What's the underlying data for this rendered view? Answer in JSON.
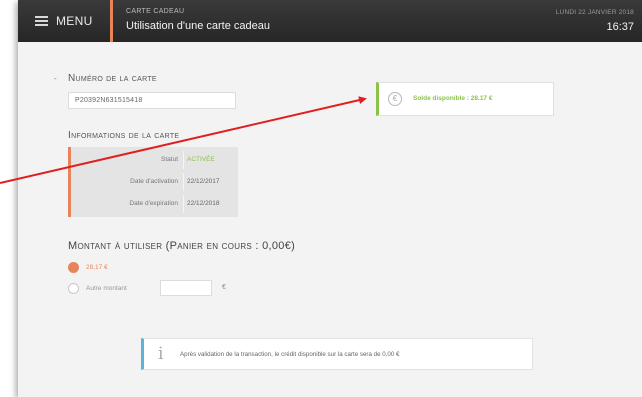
{
  "header": {
    "menu_label": "MENU",
    "menu_icon": "hamburger-icon",
    "breadcrumb": "CARTE CADEAU",
    "title": "Utilisation d'une carte cadeau",
    "date": "LUNDI 22 JANVIER 2018",
    "time": "16:37"
  },
  "card_number": {
    "title": "Numéro de la carte",
    "value": "P20392N631515418"
  },
  "balance": {
    "icon": "euro-icon",
    "text": "Solde disponible : 28.17 €"
  },
  "card_info": {
    "title": "Informations de la carte",
    "rows": [
      {
        "label": "Statut",
        "value": "ACTIVÉE"
      },
      {
        "label": "Date d'activation",
        "value": "22/12/2017"
      },
      {
        "label": "Date d'expiration",
        "value": "22/12/2018"
      }
    ]
  },
  "amount": {
    "title": "Montant à utiliser (Panier en cours : 0,00€)",
    "option_full": "28,17 €",
    "option_other": "Autre montant",
    "other_value": "",
    "unit": "€"
  },
  "notice": {
    "icon": "info-icon",
    "text": "Après validation de la transaction, le crédit disponible sur la carte sera de 0,00 €"
  },
  "colors": {
    "accent_orange": "#e8845a",
    "balance_green": "#8bc34a",
    "notice_blue": "#5ab4d6",
    "arrow_red": "#e02020"
  }
}
